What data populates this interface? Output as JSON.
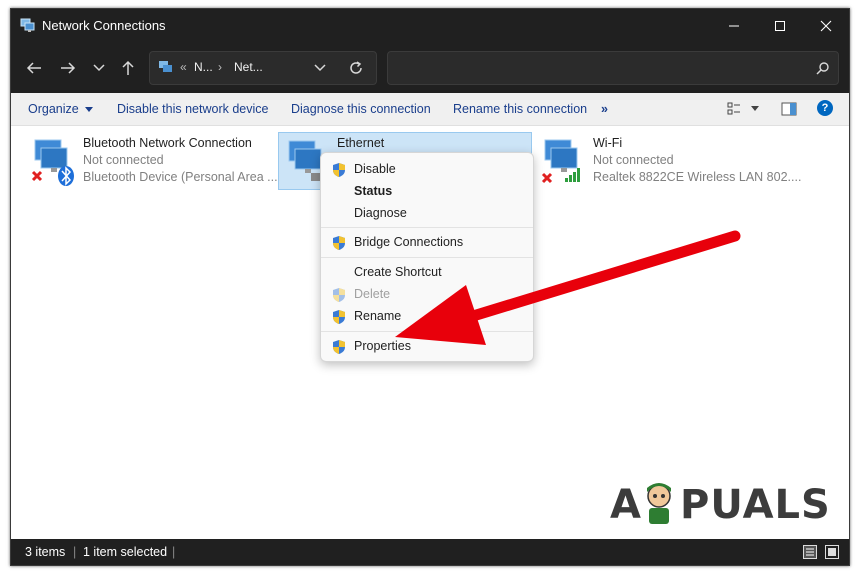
{
  "window": {
    "title": "Network Connections",
    "title_icon": "network-connections-icon"
  },
  "titlebar_buttons": [
    "minimize-icon",
    "maximize-icon",
    "close-icon"
  ],
  "address_bar": {
    "crumbs": [
      "«",
      "N...",
      "›",
      "Net..."
    ],
    "search_placeholder": ""
  },
  "commands": {
    "organize": "Organize",
    "disable": "Disable this network device",
    "diagnose": "Diagnose this connection",
    "rename": "Rename this connection",
    "more": "»"
  },
  "items": [
    {
      "name": "Bluetooth Network Connection",
      "status": "Not connected",
      "device": "Bluetooth Device (Personal Area ..."
    },
    {
      "name": "Ethernet",
      "status": "",
      "device": ""
    },
    {
      "name": "Wi-Fi",
      "status": "Not connected",
      "device": "Realtek 8822CE Wireless LAN 802...."
    }
  ],
  "context_menu": {
    "items": [
      {
        "label": "Disable",
        "shield": true,
        "bold": false,
        "disabled": false
      },
      {
        "label": "Status",
        "shield": false,
        "bold": true,
        "disabled": false
      },
      {
        "label": "Diagnose",
        "shield": false,
        "bold": false,
        "disabled": false
      },
      {
        "label": "Bridge Connections",
        "shield": true,
        "bold": false,
        "disabled": false
      },
      {
        "label": "Create Shortcut",
        "shield": false,
        "bold": false,
        "disabled": false
      },
      {
        "label": "Delete",
        "shield": true,
        "bold": false,
        "disabled": true
      },
      {
        "label": "Rename",
        "shield": true,
        "bold": false,
        "disabled": false
      },
      {
        "label": "Properties",
        "shield": true,
        "bold": false,
        "disabled": false
      }
    ]
  },
  "status_bar": {
    "count": "3 items",
    "selected": "1 item selected",
    "divider": "|"
  },
  "watermark": {
    "text_a": "A",
    "text_rest": "PUALS"
  },
  "colors": {
    "accent": "#0067c0",
    "arrow": "#e8000b",
    "dark_chrome": "#202020"
  }
}
